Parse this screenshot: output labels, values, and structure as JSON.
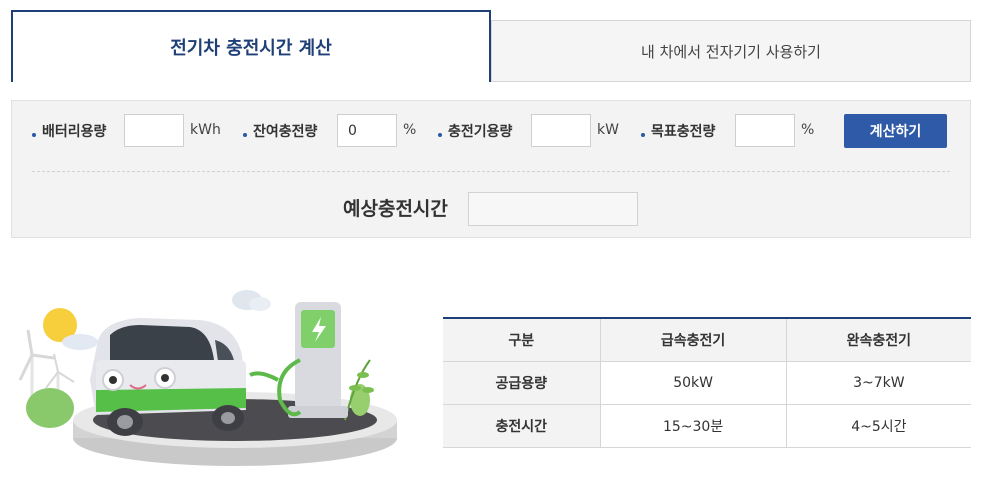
{
  "tabs": [
    {
      "label": "전기차 충전시간 계산",
      "active": true
    },
    {
      "label": "내 차에서 전자기기 사용하기",
      "active": false
    }
  ],
  "calculator": {
    "battery": {
      "label": "배터리용량",
      "value": "",
      "unit": "kWh"
    },
    "remaining": {
      "label": "잔여충전량",
      "value": "0",
      "unit": "%"
    },
    "charger": {
      "label": "충전기용량",
      "value": "",
      "unit": "kW"
    },
    "target": {
      "label": "목표충전량",
      "value": "",
      "unit": "%"
    },
    "button_label": "계산하기",
    "result_label": "예상충전시간",
    "result_value": ""
  },
  "spec_table": {
    "headers": [
      "구분",
      "급속충전기",
      "완속충전기"
    ],
    "rows": [
      {
        "label": "공급용량",
        "fast": "50kW",
        "slow": "3~7kW"
      },
      {
        "label": "충전시간",
        "fast": "15~30분",
        "slow": "4~5시간"
      }
    ]
  },
  "colors": {
    "primary": "#1f3f78",
    "button": "#2e5aa7",
    "panel": "#f3f3f3"
  }
}
